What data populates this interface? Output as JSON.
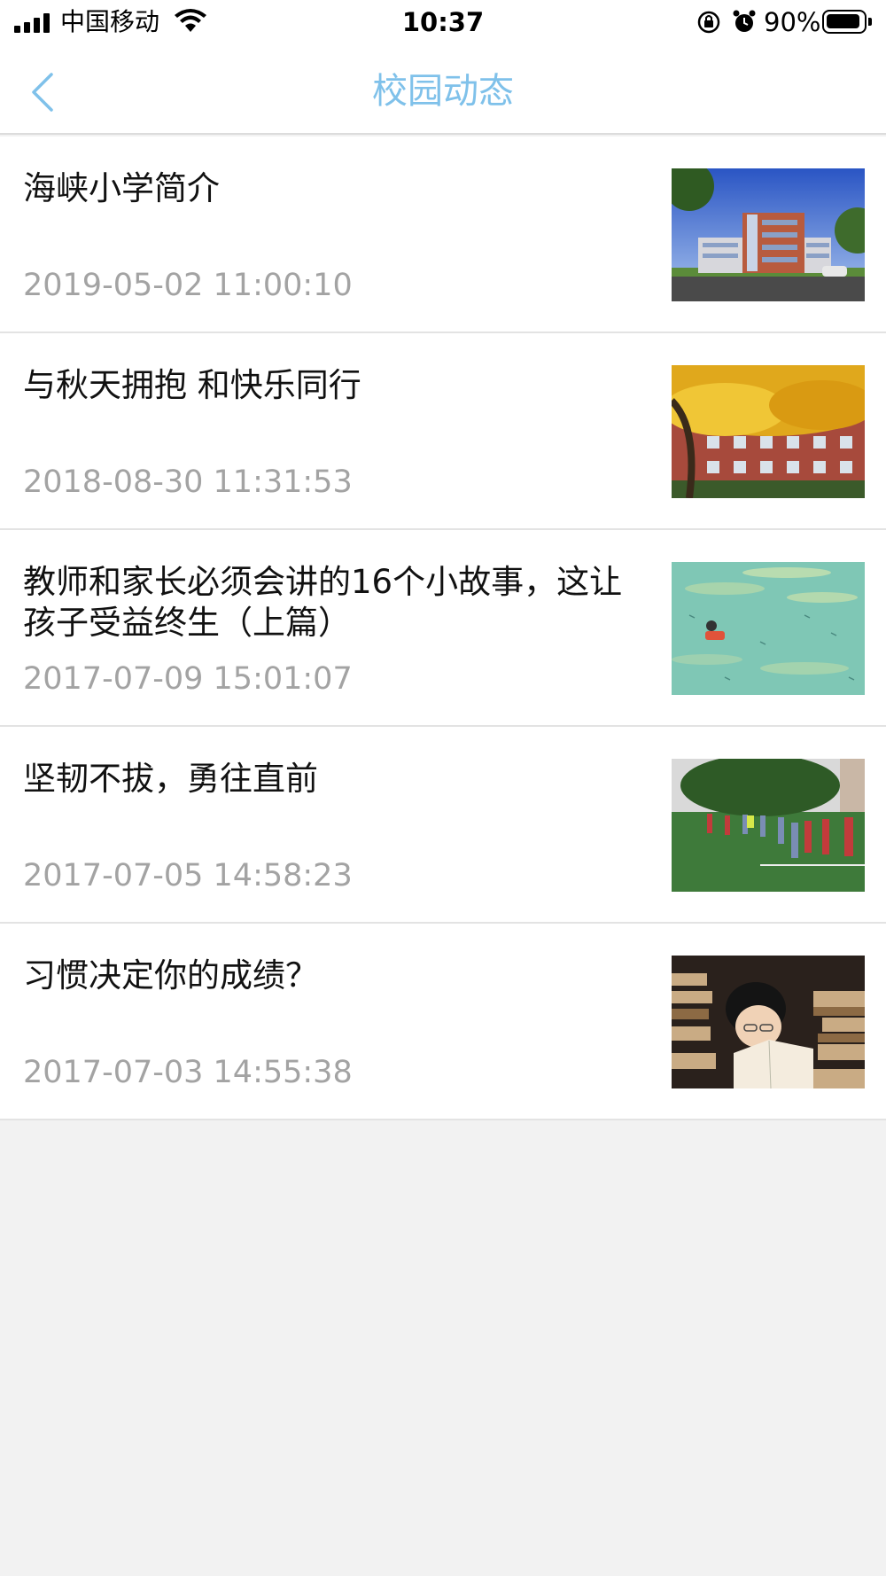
{
  "status_bar": {
    "carrier": "中国移动",
    "time": "10:37",
    "battery_percent": "90%",
    "battery_level": 0.9,
    "icons": [
      "signal-icon",
      "wifi-icon",
      "rotation-lock-icon",
      "alarm-icon",
      "battery-icon"
    ]
  },
  "nav": {
    "title": "校园动态",
    "back_icon": "chevron-left-icon",
    "accent_color": "#7fc1ea"
  },
  "news": [
    {
      "title": "海峡小学简介",
      "time": "2019-05-02 11:00:10",
      "thumbnail": "school-building-photo"
    },
    {
      "title": "与秋天拥抱 和快乐同行",
      "time": "2018-08-30 11:31:53",
      "thumbnail": "autumn-tree-photo"
    },
    {
      "title": "教师和家长必须会讲的16个小故事，这让孩子受益终生（上篇）",
      "time": "2017-07-09 15:01:07",
      "thumbnail": "swimming-child-illustration"
    },
    {
      "title": "坚韧不拔，勇往直前",
      "time": "2017-07-05 14:58:23",
      "thumbnail": "students-sports-field-photo"
    },
    {
      "title": "习惯决定你的成绩？",
      "time": "2017-07-03 14:55:38",
      "thumbnail": "child-reading-books-photo"
    }
  ]
}
